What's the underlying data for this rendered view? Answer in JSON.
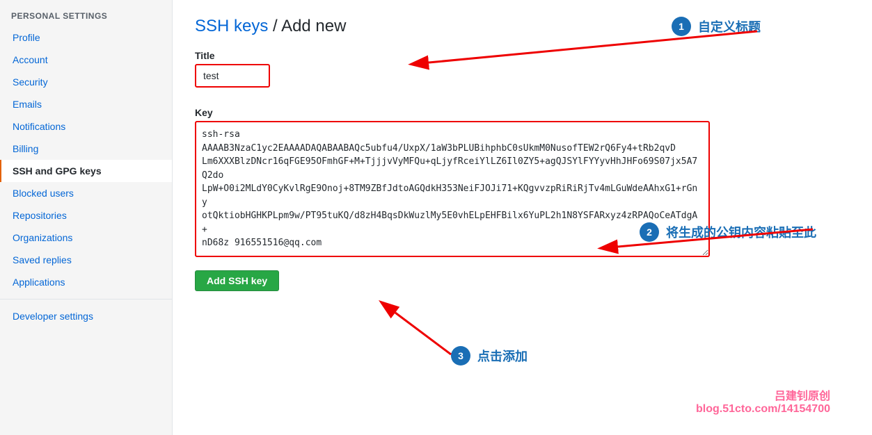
{
  "sidebar": {
    "header": "Personal settings",
    "items": [
      {
        "id": "profile",
        "label": "Profile",
        "active": false
      },
      {
        "id": "account",
        "label": "Account",
        "active": false
      },
      {
        "id": "security",
        "label": "Security",
        "active": false
      },
      {
        "id": "emails",
        "label": "Emails",
        "active": false
      },
      {
        "id": "notifications",
        "label": "Notifications",
        "active": false
      },
      {
        "id": "billing",
        "label": "Billing",
        "active": false
      },
      {
        "id": "ssh-gpg-keys",
        "label": "SSH and GPG keys",
        "active": true
      },
      {
        "id": "blocked-users",
        "label": "Blocked users",
        "active": false
      },
      {
        "id": "repositories",
        "label": "Repositories",
        "active": false
      },
      {
        "id": "organizations",
        "label": "Organizations",
        "active": false
      },
      {
        "id": "saved-replies",
        "label": "Saved replies",
        "active": false
      },
      {
        "id": "applications",
        "label": "Applications",
        "active": false
      }
    ],
    "developer_settings": "Developer settings"
  },
  "page": {
    "breadcrumb_link": "SSH keys",
    "breadcrumb_separator": " / ",
    "breadcrumb_current": "Add new",
    "title_label": "Title",
    "title_value": "test",
    "key_label": "Key",
    "key_value": "ssh-rsa\nAAAAB3NzaC1yc2EAAAADAQABAABAQc5ubfu4/UxpX/1aW3bPLUBihphbC0sUkmM0NusofTEW2rQ6Fy4+tRb2qvDLm6XXXBlzDNcr16qFGE95OFmhGF+M+TjjjvVyMFQu+qLjyfRceiYlLZ6Il0ZY5+agQJSYlFYYyvHhJHFo69S07jx5A7Q2doLpW+O0i2MLdY0CyKvlRgE9Onoj+8TM9ZBfJdtoAGQdkH353NeiFJOJi71+KQgvvzpRiRiRjTv4mLGuWdeAAhxG1+rGnyotQktiobHGHKPLpm9w/PT95tuKQ/d8zH4BqsDkWuzlMy5E0vhELpEHFBilx6YuPL2h1N8YSFARxyz4zRPAQoCeATdgA+nD68z 916551516@qq.com",
    "add_button": "Add SSH key",
    "annotation1_num": "1",
    "annotation1_text": "自定义标题",
    "annotation2_num": "2",
    "annotation2_text": "将生成的公钥内容粘贴至此",
    "annotation3_num": "3",
    "annotation3_text": "点击添加",
    "watermark1": "吕建钊原创",
    "watermark2": "blog.51cto.com/14154700"
  }
}
